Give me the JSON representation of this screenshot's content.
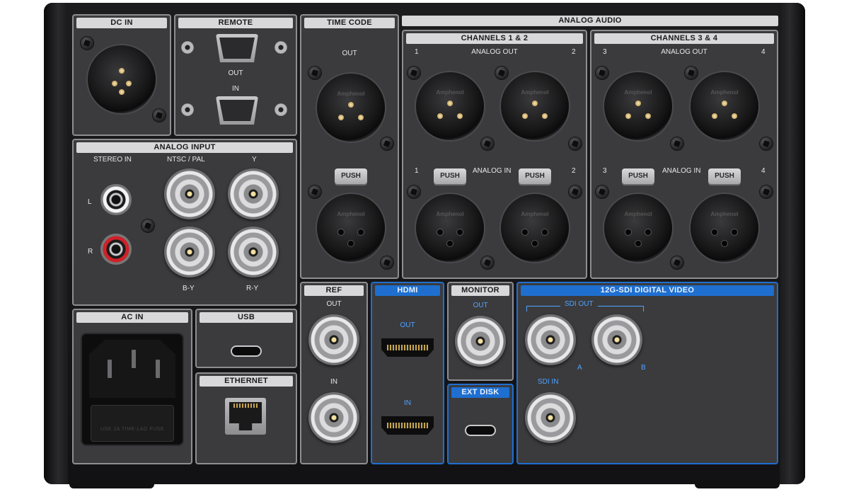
{
  "device": {
    "connector_brand": "Amphenol"
  },
  "panels": {
    "dc_in": {
      "title": "DC IN"
    },
    "remote": {
      "title": "REMOTE",
      "out_label": "OUT",
      "in_label": "IN"
    },
    "time_code": {
      "title": "TIME CODE",
      "out_label": "OUT",
      "push_label": "PUSH"
    },
    "analog_audio": {
      "title": "ANALOG AUDIO",
      "ch12": {
        "title": "CHANNELS 1 & 2",
        "out_label": "ANALOG OUT",
        "in_label": "ANALOG IN",
        "n1": "1",
        "n2": "2"
      },
      "ch34": {
        "title": "CHANNELS 3 & 4",
        "out_label": "ANALOG OUT",
        "in_label": "ANALOG IN",
        "n1": "3",
        "n2": "4"
      },
      "push_label": "PUSH"
    },
    "analog_input": {
      "title": "ANALOG INPUT",
      "stereo_in": "STEREO IN",
      "ntsc_pal": "NTSC / PAL",
      "y": "Y",
      "l": "L",
      "r": "R",
      "b_y": "B-Y",
      "r_y": "R-Y"
    },
    "ref": {
      "title": "REF",
      "out_label": "OUT",
      "in_label": "IN"
    },
    "hdmi": {
      "title": "HDMI",
      "out_label": "OUT",
      "in_label": "IN"
    },
    "monitor": {
      "title": "MONITOR",
      "out_label": "OUT"
    },
    "ext_disk": {
      "title": "EXT DISK"
    },
    "sdi": {
      "title": "12G-SDI DIGITAL VIDEO",
      "sdi_out": "SDI OUT",
      "a": "A",
      "b": "B",
      "sdi_in": "SDI IN"
    },
    "ac_in": {
      "title": "AC IN",
      "fuse_text": "USE 2A TIME-LAG FUSE"
    },
    "usb": {
      "title": "USB"
    },
    "ethernet": {
      "title": "ETHERNET"
    }
  },
  "colors": {
    "accent_blue": "#1e6fd0",
    "panel_border": "#8e8e92",
    "header_fill": "#d8d8da",
    "rca_left": "#f4f4f6",
    "rca_right": "#d02028"
  }
}
